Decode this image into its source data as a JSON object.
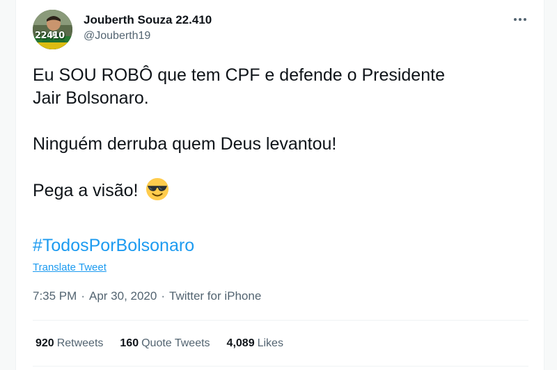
{
  "tweet": {
    "author": {
      "display_name": "Jouberth Souza 22.410",
      "handle": "@Jouberth19",
      "avatar_badge": "22410"
    },
    "more_icon": "more-horizontal-icon",
    "text": {
      "line1": "Eu SOU ROBÔ que tem CPF e defende o Presidente",
      "line2": "Jair Bolsonaro.",
      "line3": "Ninguém derruba quem Deus levantou!",
      "line4": "Pega a visão!",
      "emoji": "smiling-face-with-sunglasses-icon"
    },
    "hashtag": "#TodosPorBolsonaro",
    "translate_label": "Translate Tweet",
    "meta": {
      "time": "7:35 PM",
      "separator": "·",
      "date": "Apr 30, 2020",
      "source": "Twitter for iPhone"
    },
    "stats": {
      "retweets_count": "920",
      "retweets_label": "Retweets",
      "quotes_count": "160",
      "quotes_label": "Quote Tweets",
      "likes_count": "4,089",
      "likes_label": "Likes"
    }
  },
  "colors": {
    "link": "#1d9bf0",
    "text": "#0f1419",
    "secondary": "#536471",
    "divider": "#eff3f4"
  }
}
